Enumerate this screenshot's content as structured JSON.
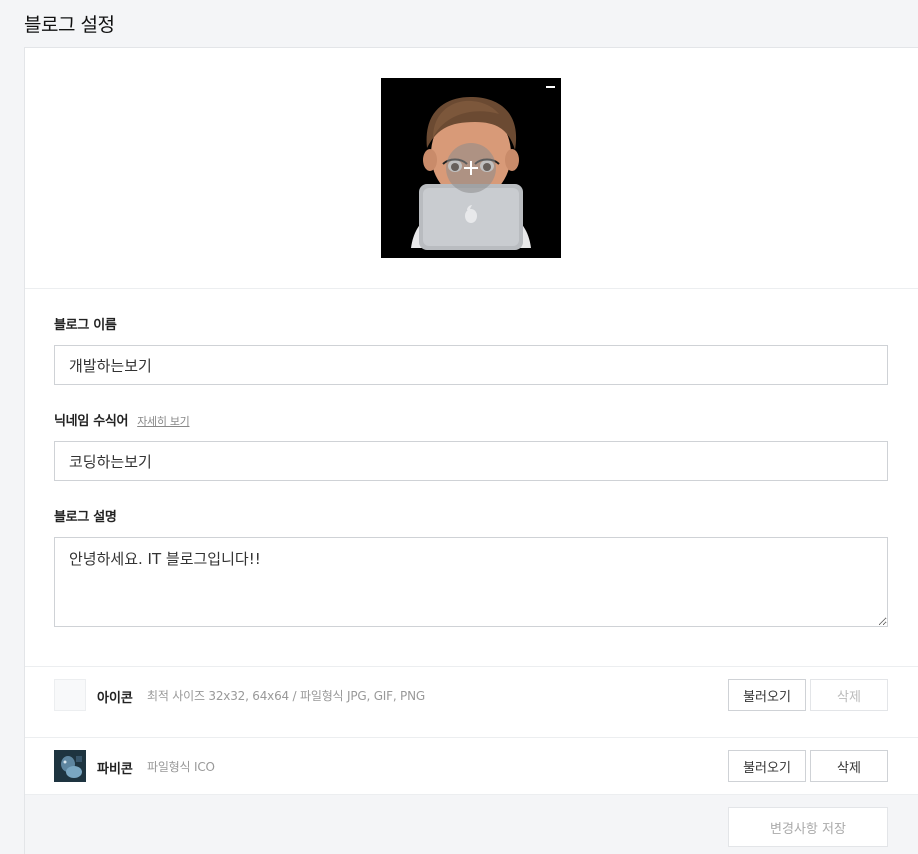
{
  "page": {
    "title": "블로그 설정"
  },
  "profile": {
    "image_alt": "프로필 이미지",
    "remove_icon": "minus-icon",
    "add_icon": "plus-icon"
  },
  "form": {
    "blog_name": {
      "label": "블로그 이름",
      "value": "개발하는보기"
    },
    "nickname_modifier": {
      "label": "닉네임 수식어",
      "help_link": "자세히 보기",
      "value": "코딩하는보기"
    },
    "blog_description": {
      "label": "블로그 설명",
      "value": "안녕하세요. IT 블로그입니다!!"
    }
  },
  "icon": {
    "title": "아이콘",
    "description": "최적 사이즈 32x32, 64x64 / 파일형식 JPG, GIF, PNG",
    "load_label": "불러오기",
    "delete_label": "삭제"
  },
  "favicon": {
    "title": "파비콘",
    "description": "파일형식 ICO",
    "load_label": "불러오기",
    "delete_label": "삭제"
  },
  "footer": {
    "save_label": "변경사항 저장"
  }
}
